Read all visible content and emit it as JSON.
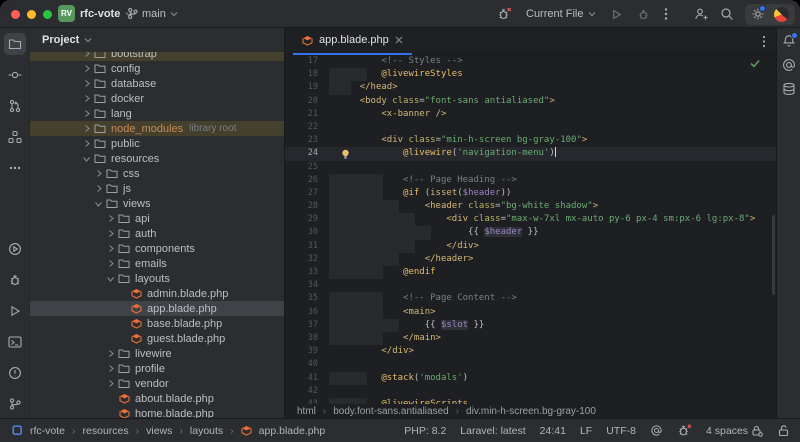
{
  "title_bar": {
    "project_badge": "RV",
    "project_name": "rfc-vote",
    "branch_name": "main",
    "run_configuration": "Current File"
  },
  "left_toolbar": {
    "top_icons": [
      "project-folder",
      "commit",
      "pull-requests",
      "structure",
      "more"
    ],
    "bottom_icons": [
      "services",
      "debug",
      "run",
      "terminal",
      "problems",
      "version-control"
    ]
  },
  "right_toolbar": {
    "icons": [
      "notifications",
      "mentions",
      "database"
    ]
  },
  "project_panel": {
    "header": "Project",
    "items": [
      {
        "label": "bootstrap",
        "type": "folder",
        "level": 1,
        "chevron": "collapsed",
        "highlight": "library",
        "clipped": true
      },
      {
        "label": "config",
        "type": "folder",
        "level": 1,
        "chevron": "collapsed"
      },
      {
        "label": "database",
        "type": "folder",
        "level": 1,
        "chevron": "collapsed"
      },
      {
        "label": "docker",
        "type": "folder",
        "level": 1,
        "chevron": "collapsed"
      },
      {
        "label": "lang",
        "type": "folder",
        "level": 1,
        "chevron": "collapsed"
      },
      {
        "label": "node_modules",
        "type": "folder",
        "level": 1,
        "chevron": "collapsed",
        "highlight": "library",
        "label_style": "library-root",
        "suffix": "library root"
      },
      {
        "label": "public",
        "type": "folder",
        "level": 1,
        "chevron": "collapsed"
      },
      {
        "label": "resources",
        "type": "folder",
        "level": 1,
        "chevron": "expanded"
      },
      {
        "label": "css",
        "type": "folder",
        "level": 2,
        "chevron": "collapsed"
      },
      {
        "label": "js",
        "type": "folder",
        "level": 2,
        "chevron": "collapsed"
      },
      {
        "label": "views",
        "type": "folder",
        "level": 2,
        "chevron": "expanded"
      },
      {
        "label": "api",
        "type": "folder",
        "level": 3,
        "chevron": "collapsed"
      },
      {
        "label": "auth",
        "type": "folder",
        "level": 3,
        "chevron": "collapsed"
      },
      {
        "label": "components",
        "type": "folder",
        "level": 3,
        "chevron": "collapsed"
      },
      {
        "label": "emails",
        "type": "folder",
        "level": 3,
        "chevron": "collapsed"
      },
      {
        "label": "layouts",
        "type": "folder",
        "level": 3,
        "chevron": "expanded"
      },
      {
        "label": "admin.blade.php",
        "type": "blade-file",
        "level": 4
      },
      {
        "label": "app.blade.php",
        "type": "blade-file",
        "level": 4,
        "highlight": "selected"
      },
      {
        "label": "base.blade.php",
        "type": "blade-file",
        "level": 4
      },
      {
        "label": "guest.blade.php",
        "type": "blade-file",
        "level": 4
      },
      {
        "label": "livewire",
        "type": "folder",
        "level": 3,
        "chevron": "collapsed"
      },
      {
        "label": "profile",
        "type": "folder",
        "level": 3,
        "chevron": "collapsed"
      },
      {
        "label": "vendor",
        "type": "folder",
        "level": 3,
        "chevron": "collapsed"
      },
      {
        "label": "about.blade.php",
        "type": "blade-file",
        "level": 3
      },
      {
        "label": "home.blade.php",
        "type": "blade-file",
        "level": 3
      }
    ]
  },
  "editor": {
    "tab": {
      "label": "app.blade.php"
    },
    "inspection_status": "ok",
    "breadcrumbs": [
      "html",
      "body.font-sans.antialiased",
      "div.min-h-screen.bg-gray-100"
    ],
    "lines": [
      {
        "n": 17,
        "tokens": [
          [
            "        ",
            "pl"
          ],
          [
            "<!-- Styles -->",
            "cm"
          ]
        ]
      },
      {
        "n": 18,
        "inj": true,
        "tokens": [
          [
            "        ",
            "pl"
          ],
          [
            "@livewireStyles",
            "dir"
          ]
        ]
      },
      {
        "n": 19,
        "inj": true,
        "tokens": [
          [
            "    ",
            "pl"
          ],
          [
            "</head>",
            "tag"
          ]
        ]
      },
      {
        "n": 20,
        "tokens": [
          [
            "    ",
            "pl"
          ],
          [
            "<body",
            "tag"
          ],
          [
            " ",
            "pl"
          ],
          [
            "class",
            "attr"
          ],
          [
            "=",
            "pu"
          ],
          [
            "\"font-sans antialiased\"",
            "str"
          ],
          [
            ">",
            "tag"
          ]
        ]
      },
      {
        "n": 21,
        "tokens": [
          [
            "        ",
            "pl"
          ],
          [
            "<x-banner />",
            "tag"
          ]
        ]
      },
      {
        "n": 22,
        "tokens": []
      },
      {
        "n": 23,
        "tokens": [
          [
            "        ",
            "pl"
          ],
          [
            "<div",
            "tag"
          ],
          [
            " ",
            "pl"
          ],
          [
            "class",
            "attr"
          ],
          [
            "=",
            "pu"
          ],
          [
            "\"min-h-screen bg-gray-100\"",
            "str"
          ],
          [
            ">",
            "tag"
          ]
        ]
      },
      {
        "n": 24,
        "current": true,
        "bulb": true,
        "caret": true,
        "tokens": [
          [
            "            ",
            "pl"
          ],
          [
            "@livewire",
            "dir"
          ],
          [
            "(",
            "pu"
          ],
          [
            "'navigation-menu'",
            "str"
          ],
          [
            ")",
            "pu"
          ]
        ]
      },
      {
        "n": 25,
        "tokens": []
      },
      {
        "n": 26,
        "inj": true,
        "tokens": [
          [
            "            ",
            "pl"
          ],
          [
            "<!-- Page Heading -->",
            "cm"
          ]
        ]
      },
      {
        "n": 27,
        "inj": true,
        "tokens": [
          [
            "            ",
            "pl"
          ],
          [
            "@if",
            "dir"
          ],
          [
            " (",
            "pu"
          ],
          [
            "isset",
            "fn"
          ],
          [
            "(",
            "pu"
          ],
          [
            "$header",
            "var"
          ],
          [
            "))",
            "pu"
          ]
        ]
      },
      {
        "n": 28,
        "inj": true,
        "tokens": [
          [
            "                ",
            "pl"
          ],
          [
            "<header",
            "tag"
          ],
          [
            " ",
            "pl"
          ],
          [
            "class",
            "attr"
          ],
          [
            "=",
            "pu"
          ],
          [
            "\"bg-white shadow\"",
            "str"
          ],
          [
            ">",
            "tag"
          ]
        ]
      },
      {
        "n": 29,
        "inj": true,
        "tokens": [
          [
            "                    ",
            "pl"
          ],
          [
            "<div",
            "tag"
          ],
          [
            " ",
            "pl"
          ],
          [
            "class",
            "attr"
          ],
          [
            "=",
            "pu"
          ],
          [
            "\"max-w-7xl mx-auto py-6 px-4 sm:px-6 lg:px-8\"",
            "str"
          ],
          [
            ">",
            "tag"
          ]
        ]
      },
      {
        "n": 30,
        "inj": true,
        "tokens": [
          [
            "                        ",
            "pl"
          ],
          [
            "{{ ",
            "pu"
          ],
          [
            "$header",
            "varbg"
          ],
          [
            " }}",
            "pu"
          ]
        ]
      },
      {
        "n": 31,
        "inj": true,
        "tokens": [
          [
            "                    ",
            "pl"
          ],
          [
            "</div>",
            "tag"
          ]
        ]
      },
      {
        "n": 32,
        "inj": true,
        "tokens": [
          [
            "                ",
            "pl"
          ],
          [
            "</header>",
            "tag"
          ]
        ]
      },
      {
        "n": 33,
        "inj": true,
        "tokens": [
          [
            "            ",
            "pl"
          ],
          [
            "@endif",
            "dir"
          ]
        ]
      },
      {
        "n": 34,
        "tokens": []
      },
      {
        "n": 35,
        "inj": true,
        "tokens": [
          [
            "            ",
            "pl"
          ],
          [
            "<!-- Page Content -->",
            "cm"
          ]
        ]
      },
      {
        "n": 36,
        "inj": true,
        "tokens": [
          [
            "            ",
            "pl"
          ],
          [
            "<main>",
            "tag"
          ]
        ]
      },
      {
        "n": 37,
        "inj": true,
        "tokens": [
          [
            "                ",
            "pl"
          ],
          [
            "{{ ",
            "pu"
          ],
          [
            "$slot",
            "varbg"
          ],
          [
            " }}",
            "pu"
          ]
        ]
      },
      {
        "n": 38,
        "inj": true,
        "tokens": [
          [
            "            ",
            "pl"
          ],
          [
            "</main>",
            "tag"
          ]
        ]
      },
      {
        "n": 39,
        "tokens": [
          [
            "        ",
            "pl"
          ],
          [
            "</div>",
            "tag"
          ]
        ]
      },
      {
        "n": 40,
        "tokens": []
      },
      {
        "n": 41,
        "inj": true,
        "tokens": [
          [
            "        ",
            "pl"
          ],
          [
            "@stack",
            "dir"
          ],
          [
            "(",
            "pu"
          ],
          [
            "'modals'",
            "str"
          ],
          [
            ")",
            "pu"
          ]
        ]
      },
      {
        "n": 42,
        "tokens": []
      },
      {
        "n": 43,
        "inj": true,
        "tokens": [
          [
            "        ",
            "pl"
          ],
          [
            "@livewireScripts",
            "dir"
          ]
        ]
      }
    ]
  },
  "status_bar": {
    "path": [
      "rfc-vote",
      "resources",
      "views",
      "layouts",
      "app.blade.php"
    ],
    "php_version": "PHP: 8.2",
    "laravel_version": "Laravel: latest",
    "caret_position": "24:41",
    "line_separator": "LF",
    "encoding": "UTF-8",
    "indent": "4 spaces"
  },
  "colors": {
    "accent": "#3574f0",
    "laravel_orange": "#e8703a",
    "inspection_green": "#5c9a5f",
    "traffic_red": "#ff5f57",
    "traffic_yellow": "#febc2e",
    "traffic_green": "#29c53f"
  }
}
